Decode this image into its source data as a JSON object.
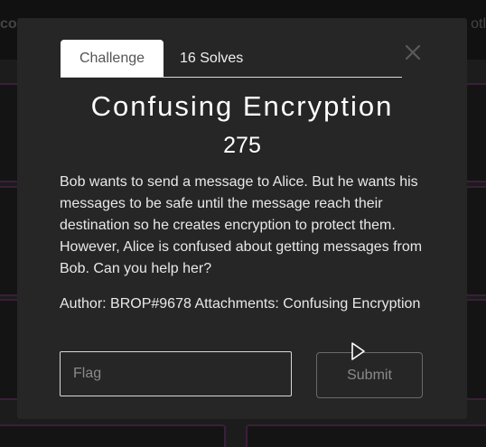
{
  "background": {
    "brand_fragment": "co",
    "right_link_fragment": "otl"
  },
  "modal": {
    "tabs": [
      {
        "label": "Challenge",
        "active": true
      },
      {
        "label": "16 Solves",
        "active": false
      }
    ],
    "title": "Confusing Encryption",
    "points": "275",
    "description": "Bob wants to send a message to Alice. But he wants his messages to be safe until the message reach their destination so he creates encryption to protect them. However, Alice is confused about getting messages from Bob. Can you help her?",
    "author_label": "Author: BROP#9678",
    "attachments_label": "Attachments:",
    "attachment_link": "Confusing Encryption",
    "flag_placeholder": "Flag",
    "flag_value": "",
    "submit_label": "Submit"
  },
  "colors": {
    "modal_bg": "#262626",
    "card_border": "#3a1f3a",
    "accent_text": "#ffffff"
  }
}
